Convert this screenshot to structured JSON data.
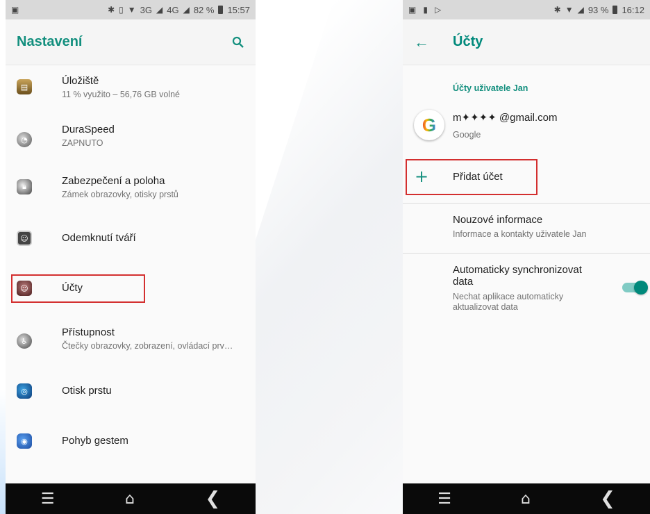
{
  "left": {
    "status": {
      "icons": [
        "image-icon",
        "bluetooth-icon",
        "vibrate-icon",
        "wifi-icon"
      ],
      "network1": "3G",
      "network2": "4G",
      "battery": "82 %",
      "time": "15:57"
    },
    "title": "Nastavení",
    "items": [
      {
        "title": "Úložiště",
        "subtitle": "11 % využito – 56,76 GB volné",
        "icon": "storage-icon"
      },
      {
        "title": "DuraSpeed",
        "subtitle": "ZAPNUTO",
        "icon": "duraspeed-icon"
      },
      {
        "title": "Zabezpečení a poloha",
        "subtitle": "Zámek obrazovky, otisky prstů",
        "icon": "security-lock-icon"
      },
      {
        "title": "Odemknutí tváří",
        "subtitle": "",
        "icon": "face-unlock-icon"
      },
      {
        "title": "Účty",
        "subtitle": "",
        "icon": "accounts-icon"
      },
      {
        "title": "Přístupnost",
        "subtitle": "Čtečky obrazovky, zobrazení, ovládací prv…",
        "icon": "accessibility-icon"
      },
      {
        "title": "Otisk prstu",
        "subtitle": "",
        "icon": "fingerprint-icon"
      },
      {
        "title": "Pohyb gestem",
        "subtitle": "",
        "icon": "gesture-icon"
      }
    ]
  },
  "right": {
    "status": {
      "battery": "93 %",
      "time": "16:12"
    },
    "title": "Účty",
    "section": "Účty uživatele Jan",
    "account": {
      "email": "m✦✦✦✦ @gmail.com",
      "provider": "Google"
    },
    "add_account": "Přidat účet",
    "emergency": {
      "title": "Nouzové informace",
      "subtitle": "Informace a kontakty uživatele Jan"
    },
    "sync": {
      "title_line1": "Automaticky synchronizovat",
      "title_line2": "data",
      "subtitle_line1": "Nechat aplikace automaticky",
      "subtitle_line2": "aktualizovat data",
      "enabled": true
    }
  },
  "colors": {
    "accent": "#138f7e",
    "highlight": "#d32f2f"
  }
}
